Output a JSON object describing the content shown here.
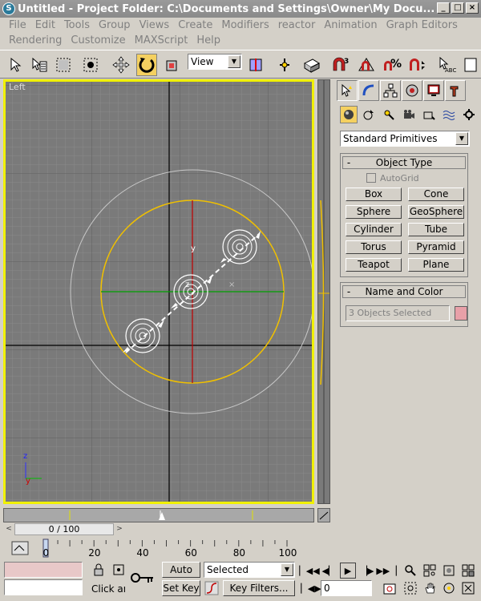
{
  "window": {
    "app_icon": "S",
    "title": "Untitled    - Project Folder: C:\\Documents and Settings\\Owner\\My Docu..."
  },
  "menu": {
    "row1": [
      "File",
      "Edit",
      "Tools",
      "Group",
      "Views",
      "Create",
      "Modifiers",
      "reactor",
      "Animation",
      "Graph Editors"
    ],
    "row2": [
      "Rendering",
      "Customize",
      "MAXScript",
      "Help"
    ]
  },
  "toolbar": {
    "reference_coord": "View",
    "active_tool": "select-rotate"
  },
  "viewport": {
    "label": "Left",
    "axis_z": "z",
    "axis_y": "y",
    "gizmo_y": "y",
    "gizmo_z": "z",
    "colors": {
      "border": "#f0f000",
      "background": "#7a7a7a",
      "grid": "#888888",
      "selection_circle": "#f0c000",
      "gizmo_x": "#00a000",
      "gizmo_y": "#c00000"
    }
  },
  "command_panel": {
    "category": "Standard Primitives",
    "object_type": {
      "title": "Object Type",
      "autogrid": "AutoGrid",
      "buttons": [
        "Box",
        "Cone",
        "Sphere",
        "GeoSphere",
        "Cylinder",
        "Tube",
        "Torus",
        "Pyramid",
        "Teapot",
        "Plane"
      ]
    },
    "name_and_color": {
      "title": "Name and Color",
      "name_value": "3 Objects Selected",
      "color": "#e8a0a8"
    }
  },
  "timeline": {
    "frame_display": "0 / 100",
    "ruler_labels": [
      "0",
      "20",
      "40",
      "60",
      "80",
      "100"
    ]
  },
  "status": {
    "auto_key": "Auto Key",
    "set_key": "Set Key",
    "key_filters": "Key Filters...",
    "selection_filter": "Selected",
    "prompt": "Click an",
    "current_frame": "0"
  }
}
